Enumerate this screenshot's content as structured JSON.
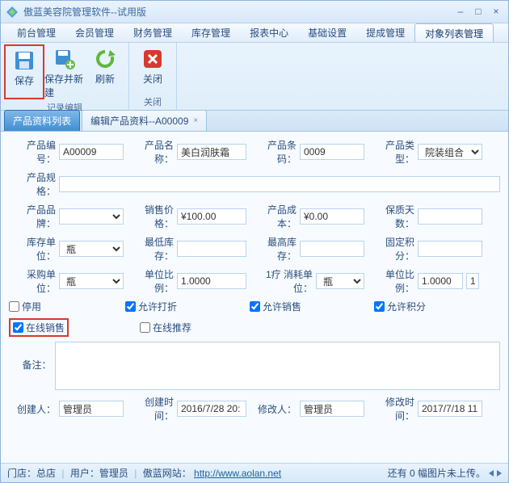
{
  "window": {
    "title": "傲蓝美容院管理软件--试用版"
  },
  "menus": [
    "前台管理",
    "会员管理",
    "财务管理",
    "库存管理",
    "报表中心",
    "基础设置",
    "提成管理",
    "对象列表管理"
  ],
  "menu_active_index": 7,
  "ribbon": {
    "group1_label": "记录编辑",
    "group2_label": "关闭",
    "save": "保存",
    "save_new": "保存并新建",
    "refresh": "刷新",
    "close": "关闭"
  },
  "tabs": {
    "list": "产品资料列表",
    "edit": "编辑产品资料--A00009"
  },
  "labels": {
    "prod_no": "产品编号：",
    "prod_name": "产品名称：",
    "barcode": "产品条码：",
    "prod_type": "产品类型：",
    "spec": "产品规格：",
    "brand": "产品品牌：",
    "price": "销售价格：",
    "cost": "产品成本：",
    "shelf": "保质天数：",
    "stock_unit": "库存单位：",
    "min_stock": "最低库存：",
    "max_stock": "最高库存：",
    "fixed_points": "固定积分：",
    "purchase_unit": "采购单位：",
    "unit_ratio1": "单位比例：",
    "consume_unit": "1疗 消耗单位：",
    "unit_ratio2": "单位比例：",
    "disable": "停用",
    "allow_discount": "允许打折",
    "allow_sale": "允许销售",
    "allow_points": "允许积分",
    "online_sale": "在线销售",
    "online_recommend": "在线推荐",
    "remark": "备注：",
    "creator": "创建人：",
    "create_time": "创建时间：",
    "modifier": "修改人：",
    "modify_time": "修改时间："
  },
  "values": {
    "prod_no": "A00009",
    "prod_name": "美白润肤霜",
    "barcode": "0009",
    "prod_type": "院装组合",
    "spec": "",
    "brand": "",
    "price": "¥100.00",
    "cost": "¥0.00",
    "shelf": "",
    "stock_unit": "瓶",
    "min_stock": "",
    "max_stock": "",
    "fixed_points": "",
    "purchase_unit": "瓶",
    "unit_ratio1": "1.0000",
    "consume_unit": "瓶",
    "unit_ratio2": "1.0000",
    "unit_ratio2_extra": "1",
    "remark": "",
    "creator": "管理员",
    "create_time": "2016/7/28 20:",
    "modifier": "管理员",
    "modify_time": "2017/7/18 11:"
  },
  "checks": {
    "disable": false,
    "allow_discount": true,
    "allow_sale": true,
    "allow_points": true,
    "online_sale": true,
    "online_recommend": false
  },
  "status": {
    "left_prefix": "门店：",
    "store": "总店",
    "user_prefix": "用户：",
    "user": "管理员",
    "site_prefix": "傲蓝网站：",
    "site_url": "http://www.aolan.net",
    "right": "还有 0 幅图片未上传。"
  }
}
